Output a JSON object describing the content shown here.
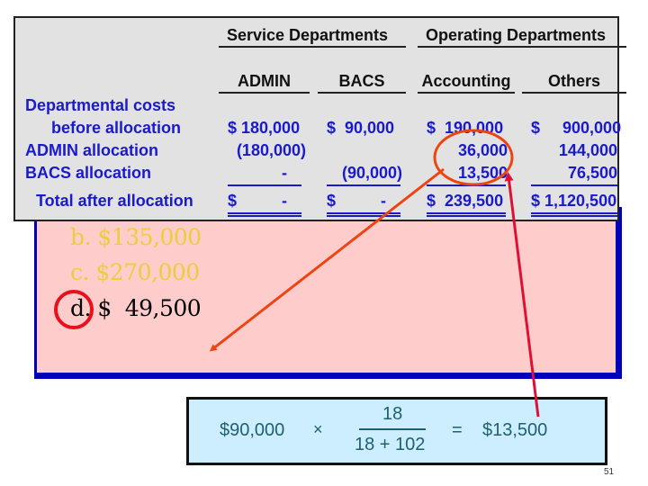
{
  "table": {
    "group_headers": [
      "Service Departments",
      "Operating Departments"
    ],
    "columns": [
      "ADMIN",
      "BACS",
      "Accounting",
      "Others"
    ],
    "rows": [
      {
        "label_lines": [
          "Departmental costs",
          "before allocation"
        ],
        "values": [
          "$ 180,000",
          "$  90,000",
          "$  190,000",
          "$     900,000"
        ]
      },
      {
        "label": "ADMIN allocation",
        "values": [
          "(180,000)",
          "",
          "36,000",
          "144,000"
        ]
      },
      {
        "label": "BACS allocation",
        "values": [
          "-",
          "(90,000)",
          "13,500",
          "76,500"
        ]
      },
      {
        "label": "Total after allocation",
        "values": [
          "$          -",
          "$          -",
          "$  239,500",
          "$ 1,120,500"
        ]
      }
    ]
  },
  "answers": [
    {
      "label": "b. $135,000",
      "state": "not-selected"
    },
    {
      "label": "c. $270,000",
      "state": "not-selected"
    },
    {
      "label": "d. $  49,500",
      "state": "selected"
    }
  ],
  "formula": {
    "base": "$90,000",
    "operator": "×",
    "numerator": "18",
    "denominator": "18 + 102",
    "equals": "=",
    "result": "$13,500"
  },
  "annotations": {
    "circle_color": "#e8101a",
    "arrow_orange": "#ee4411",
    "arrow_red": "#dd1133"
  },
  "colors": {
    "table_text": "#1a1acc",
    "pink_bg": "#ffcccc",
    "frame_blue": "#0000b8",
    "formula_bg": "#cceeff",
    "formula_text": "#1f6070",
    "answer_dim": "#e8cf3c"
  },
  "page_number": "51"
}
